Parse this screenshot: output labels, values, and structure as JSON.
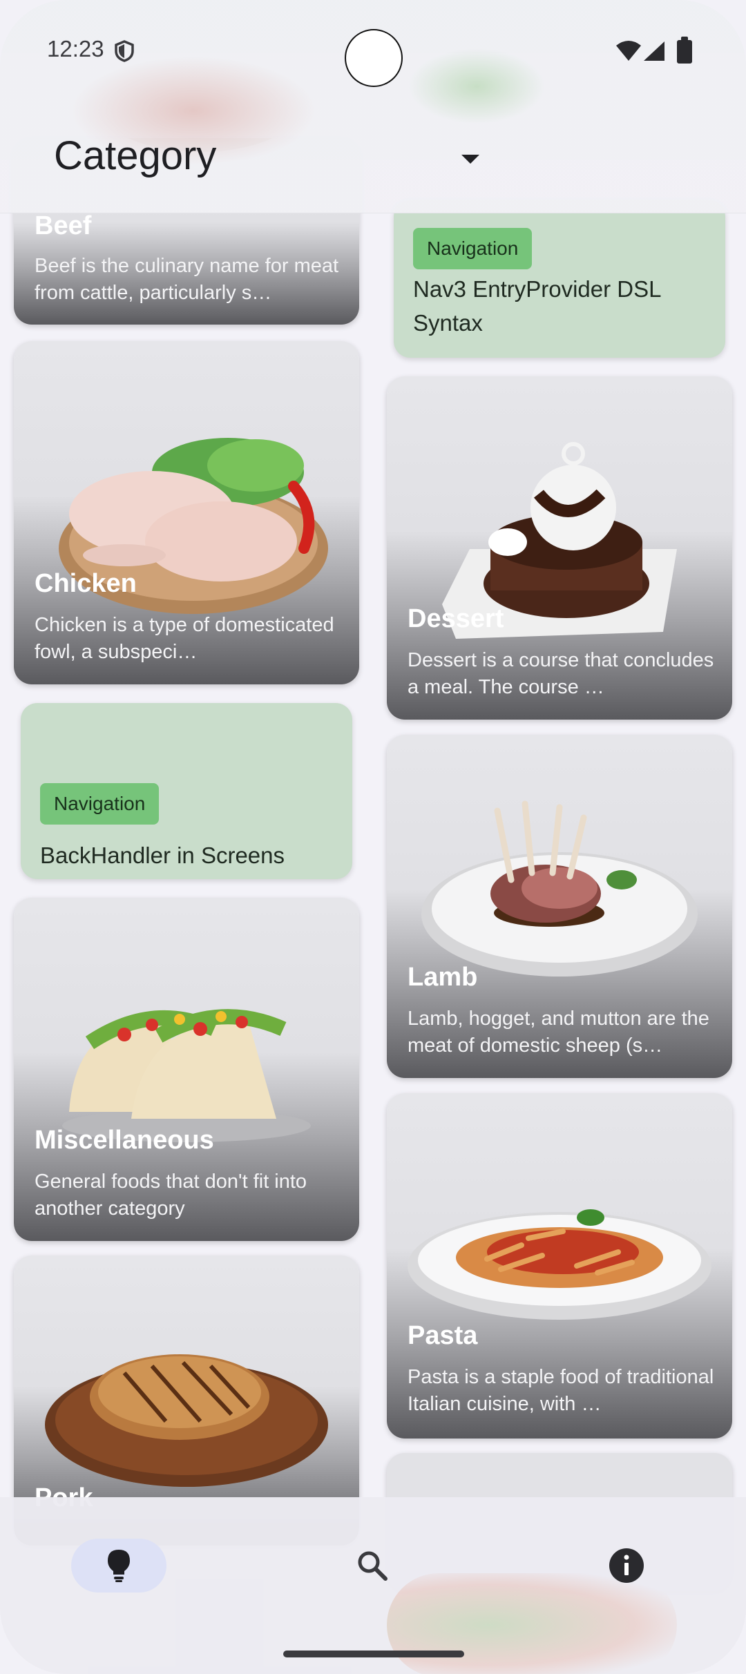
{
  "status_bar": {
    "time": "12:23"
  },
  "app_bar": {
    "title": "Category",
    "dropdown_icon": "arrow-drop-down-icon"
  },
  "left_column": [
    {
      "type": "category",
      "title": "Beef",
      "description": "Beef is the culinary name for meat from cattle, particularly s…"
    },
    {
      "type": "category",
      "title": "Chicken",
      "description": "Chicken is a type of domesticated fowl, a subspeci…"
    },
    {
      "type": "navigation",
      "chip": "Navigation",
      "title": "BackHandler in Screens"
    },
    {
      "type": "category",
      "title": "Miscellaneous",
      "description": "General foods that don't fit into another category"
    },
    {
      "type": "category",
      "title": "Pork",
      "description": ""
    }
  ],
  "right_column": [
    {
      "type": "navigation",
      "chip": "Navigation",
      "title": "Nav3 EntryProvider DSL Syntax"
    },
    {
      "type": "category",
      "title": "Dessert",
      "description": "Dessert is a course that concludes a meal. The course …"
    },
    {
      "type": "category",
      "title": "Lamb",
      "description": "Lamb, hogget, and mutton are the meat of domestic sheep (s…"
    },
    {
      "type": "category",
      "title": "Pasta",
      "description": "Pasta is a staple food of traditional Italian cuisine, with …"
    }
  ],
  "bottom_nav": {
    "items": [
      {
        "icon": "lightbulb-icon",
        "selected": true
      },
      {
        "icon": "search-icon",
        "selected": false
      },
      {
        "icon": "info-icon",
        "selected": false
      }
    ]
  },
  "colors": {
    "nav_card_bg": "#c9ddcb",
    "chip_bg": "#76c47a",
    "nav_indicator": "#dde1f6"
  }
}
